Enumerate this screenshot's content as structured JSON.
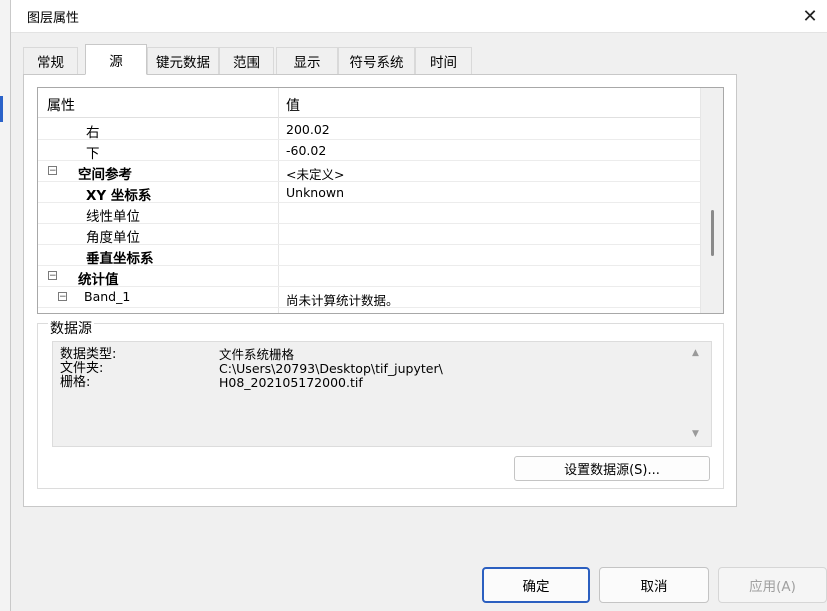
{
  "window": {
    "title": "图层属性",
    "close_glyph": "✕"
  },
  "tabs": [
    {
      "label": "常规",
      "active": false
    },
    {
      "label": "源",
      "active": true
    },
    {
      "label": "键元数据",
      "active": false
    },
    {
      "label": "范围",
      "active": false
    },
    {
      "label": "显示",
      "active": false
    },
    {
      "label": "符号系统",
      "active": false
    },
    {
      "label": "时间",
      "active": false
    }
  ],
  "grid": {
    "header_property": "属性",
    "header_value": "值",
    "rows": [
      {
        "name": "右",
        "value": "200.02",
        "bold": false,
        "expander": ""
      },
      {
        "name": "下",
        "value": "-60.02",
        "bold": false,
        "expander": ""
      },
      {
        "name": "空间参考",
        "value": "<未定义>",
        "bold": true,
        "expander": "−"
      },
      {
        "name": "XY 坐标系",
        "value": "Unknown",
        "bold": true,
        "expander": ""
      },
      {
        "name": "线性单位",
        "value": "",
        "bold": false,
        "expander": ""
      },
      {
        "name": "角度单位",
        "value": "",
        "bold": false,
        "expander": ""
      },
      {
        "name": "垂直坐标系",
        "value": "",
        "bold": true,
        "expander": ""
      },
      {
        "name": "统计值",
        "value": "",
        "bold": true,
        "expander": "−"
      },
      {
        "name": "Band_1",
        "value": "尚未计算统计数据。",
        "bold": false,
        "expander": "−"
      }
    ]
  },
  "datasource": {
    "group_label": "数据源",
    "items": [
      {
        "key": "数据类型:",
        "value": "文件系统栅格"
      },
      {
        "key": "文件夹:",
        "value": "C:\\Users\\20793\\Desktop\\tif_jupyter\\"
      },
      {
        "key": "栅格:",
        "value": "H08_202105172000.tif"
      }
    ],
    "set_source_label": "设置数据源(S)..."
  },
  "buttons": {
    "ok": "确定",
    "cancel": "取消",
    "apply": "应用(A)"
  },
  "colors": {
    "accent": "#2b5fc0",
    "selection_marker": "#2a62c9"
  }
}
